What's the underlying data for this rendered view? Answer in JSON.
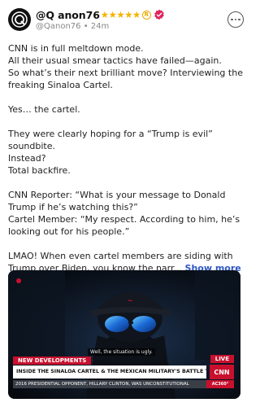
{
  "post": {
    "display_name": "@Q anon76",
    "stars": "★★★★★",
    "handle": "@Qanon76",
    "separator": " • ",
    "time": "24m",
    "paragraphs": [
      "CNN is in full meltdown mode.\nAll their usual smear tactics have failed—again.\nSo what’s their next brilliant move? Interviewing the freaking Sinaloa Cartel.",
      "Yes… the cartel.",
      "They were clearly hoping for a “Trump is evil” soundbite.\nInstead?\nTotal backfire.",
      "CNN Reporter: “What is your message to Donald Trump if he’s watching this?”\nCartel Member: “My respect. According to him, he’s looking out for his people.”"
    ],
    "last_paragraph": "LMAO! When even cartel members are siding with Trump over Biden, you know the narr...",
    "show_more": "Show more"
  },
  "media": {
    "subtitle": "Well, the situation is ugly.",
    "tag_new": "NEW DEVELOPMENTS",
    "tag_live": "LIVE",
    "headline": "INSIDE THE SINALOA CARTEL & THE MEXICAN MILITARY'S BATTLE TO DEFEAT THEM",
    "logo": "CNN",
    "ticker": "2016 PRESIDENTIAL OPPONENT, HILLARY CLINTON, WAS UNCONSTITUTIONAL",
    "ticker_extra": "AC360°"
  },
  "colors": {
    "accent_link": "#2f57c4",
    "star": "#f5b301",
    "verified": "#e0245e",
    "news_red": "#c8102e"
  },
  "icons": [
    "avatar-q-logo",
    "registered-icon",
    "verified-badge-icon",
    "more-options-icon"
  ]
}
